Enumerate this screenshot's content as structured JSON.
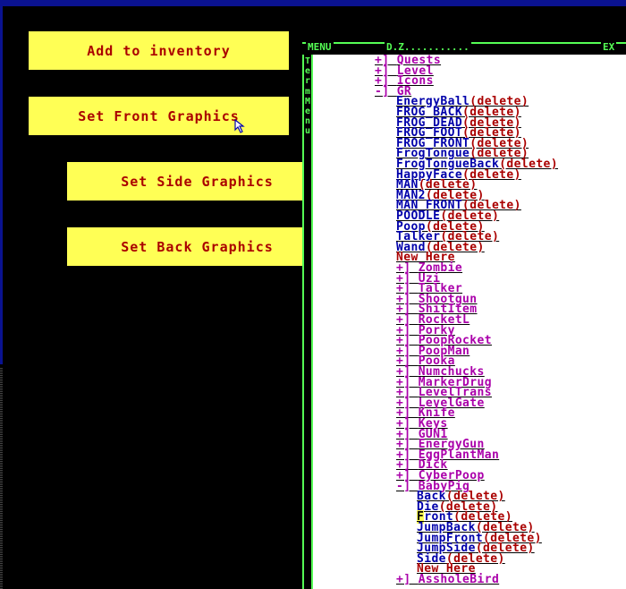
{
  "buttons": {
    "add_inventory": "Add to inventory",
    "set_front": "Set Front Graphics",
    "set_side": "Set Side Graphics",
    "set_back": "Set Back Graphics"
  },
  "menu_frame": {
    "title": "MENU",
    "path": "D.Z...........",
    "ex": "EX",
    "vertical_label": "TermMenu"
  },
  "tree": [
    {
      "indent": 0,
      "prefix": "+]",
      "label": "Quests",
      "color": "d",
      "del": false
    },
    {
      "indent": 0,
      "prefix": "+]",
      "label": "Level",
      "color": "d",
      "del": false
    },
    {
      "indent": 0,
      "prefix": "+]",
      "label": "Icons",
      "color": "d",
      "del": false
    },
    {
      "indent": 0,
      "prefix": "-]",
      "label": "GR",
      "color": "d",
      "del": false
    },
    {
      "indent": 1,
      "prefix": "",
      "label": "EnergyBall",
      "color": "b",
      "del": true
    },
    {
      "indent": 1,
      "prefix": "",
      "label": "FROG_BACK",
      "color": "b",
      "del": true
    },
    {
      "indent": 1,
      "prefix": "",
      "label": "FROG_DEAD",
      "color": "b",
      "del": true
    },
    {
      "indent": 1,
      "prefix": "",
      "label": "FROG_FOOT",
      "color": "b",
      "del": true
    },
    {
      "indent": 1,
      "prefix": "",
      "label": "FROG_FRONT",
      "color": "b",
      "del": true
    },
    {
      "indent": 1,
      "prefix": "",
      "label": "FrogTongue",
      "color": "b",
      "del": true
    },
    {
      "indent": 1,
      "prefix": "",
      "label": "FrogTongueBack",
      "color": "b",
      "del": true
    },
    {
      "indent": 1,
      "prefix": "",
      "label": "HappyFace",
      "color": "b",
      "del": true
    },
    {
      "indent": 1,
      "prefix": "",
      "label": "MAN",
      "color": "b",
      "del": true
    },
    {
      "indent": 1,
      "prefix": "",
      "label": "MAN2",
      "color": "b",
      "del": true
    },
    {
      "indent": 1,
      "prefix": "",
      "label": "MAN_FRONT",
      "color": "b",
      "del": true
    },
    {
      "indent": 1,
      "prefix": "",
      "label": "POODLE",
      "color": "b",
      "del": true
    },
    {
      "indent": 1,
      "prefix": "",
      "label": "Poop",
      "color": "b",
      "del": true
    },
    {
      "indent": 1,
      "prefix": "",
      "label": "Talker",
      "color": "b",
      "del": true
    },
    {
      "indent": 1,
      "prefix": "",
      "label": "Wand",
      "color": "b",
      "del": true
    },
    {
      "indent": 1,
      "prefix": "",
      "label": "New Here",
      "color": "r",
      "del": false
    },
    {
      "indent": 1,
      "prefix": "+]",
      "label": "Zombie",
      "color": "d",
      "del": false
    },
    {
      "indent": 1,
      "prefix": "+]",
      "label": "Uzi",
      "color": "d",
      "del": false
    },
    {
      "indent": 1,
      "prefix": "+]",
      "label": "Talker",
      "color": "d",
      "del": false
    },
    {
      "indent": 1,
      "prefix": "+]",
      "label": "Shootgun",
      "color": "d",
      "del": false
    },
    {
      "indent": 1,
      "prefix": "+]",
      "label": "ShitItem",
      "color": "d",
      "del": false
    },
    {
      "indent": 1,
      "prefix": "+]",
      "label": "RocketL",
      "color": "d",
      "del": false
    },
    {
      "indent": 1,
      "prefix": "+]",
      "label": "Porky",
      "color": "d",
      "del": false
    },
    {
      "indent": 1,
      "prefix": "+]",
      "label": "PoopRocket",
      "color": "d",
      "del": false
    },
    {
      "indent": 1,
      "prefix": "+]",
      "label": "PoopMan",
      "color": "d",
      "del": false
    },
    {
      "indent": 1,
      "prefix": "+]",
      "label": "Pooka",
      "color": "d",
      "del": false
    },
    {
      "indent": 1,
      "prefix": "+]",
      "label": "Numchucks",
      "color": "d",
      "del": false
    },
    {
      "indent": 1,
      "prefix": "+]",
      "label": "MarkerDrug",
      "color": "d",
      "del": false
    },
    {
      "indent": 1,
      "prefix": "+]",
      "label": "LevelTrans",
      "color": "d",
      "del": false
    },
    {
      "indent": 1,
      "prefix": "+]",
      "label": "LevelGate",
      "color": "d",
      "del": false
    },
    {
      "indent": 1,
      "prefix": "+]",
      "label": "Knife",
      "color": "d",
      "del": false
    },
    {
      "indent": 1,
      "prefix": "+]",
      "label": "Keys",
      "color": "d",
      "del": false
    },
    {
      "indent": 1,
      "prefix": "+]",
      "label": "GUN1",
      "color": "d",
      "del": false
    },
    {
      "indent": 1,
      "prefix": "+]",
      "label": "EnergyGun",
      "color": "d",
      "del": false
    },
    {
      "indent": 1,
      "prefix": "+]",
      "label": "EggPlantMan",
      "color": "d",
      "del": false
    },
    {
      "indent": 1,
      "prefix": "+]",
      "label": "Dick",
      "color": "d",
      "del": false
    },
    {
      "indent": 1,
      "prefix": "+]",
      "label": "CyberPoop",
      "color": "d",
      "del": false
    },
    {
      "indent": 1,
      "prefix": "-]",
      "label": "BabyPig",
      "color": "d",
      "del": false
    },
    {
      "indent": 2,
      "prefix": "",
      "label": "Back",
      "color": "b",
      "del": true
    },
    {
      "indent": 2,
      "prefix": "",
      "label": "Die",
      "color": "b",
      "del": true
    },
    {
      "indent": 2,
      "prefix": "",
      "label": "Front",
      "color": "b",
      "del": true,
      "highlight": "F"
    },
    {
      "indent": 2,
      "prefix": "",
      "label": "JumpBack",
      "color": "b",
      "del": true
    },
    {
      "indent": 2,
      "prefix": "",
      "label": "JumpFront",
      "color": "b",
      "del": true
    },
    {
      "indent": 2,
      "prefix": "",
      "label": "JumpSide",
      "color": "b",
      "del": true
    },
    {
      "indent": 2,
      "prefix": "",
      "label": "Side",
      "color": "b",
      "del": true
    },
    {
      "indent": 2,
      "prefix": "",
      "label": "New Here",
      "color": "r",
      "del": false
    },
    {
      "indent": 1,
      "prefix": "+]",
      "label": "AssholeBird",
      "color": "d",
      "del": false
    }
  ],
  "delete_label": "(delete)",
  "colors": {
    "yellow": "#ffff55",
    "dark_red": "#aa0000",
    "magenta": "#aa00aa",
    "blue": "#0000aa",
    "green": "#55ff55",
    "navy": "#0a1290"
  }
}
